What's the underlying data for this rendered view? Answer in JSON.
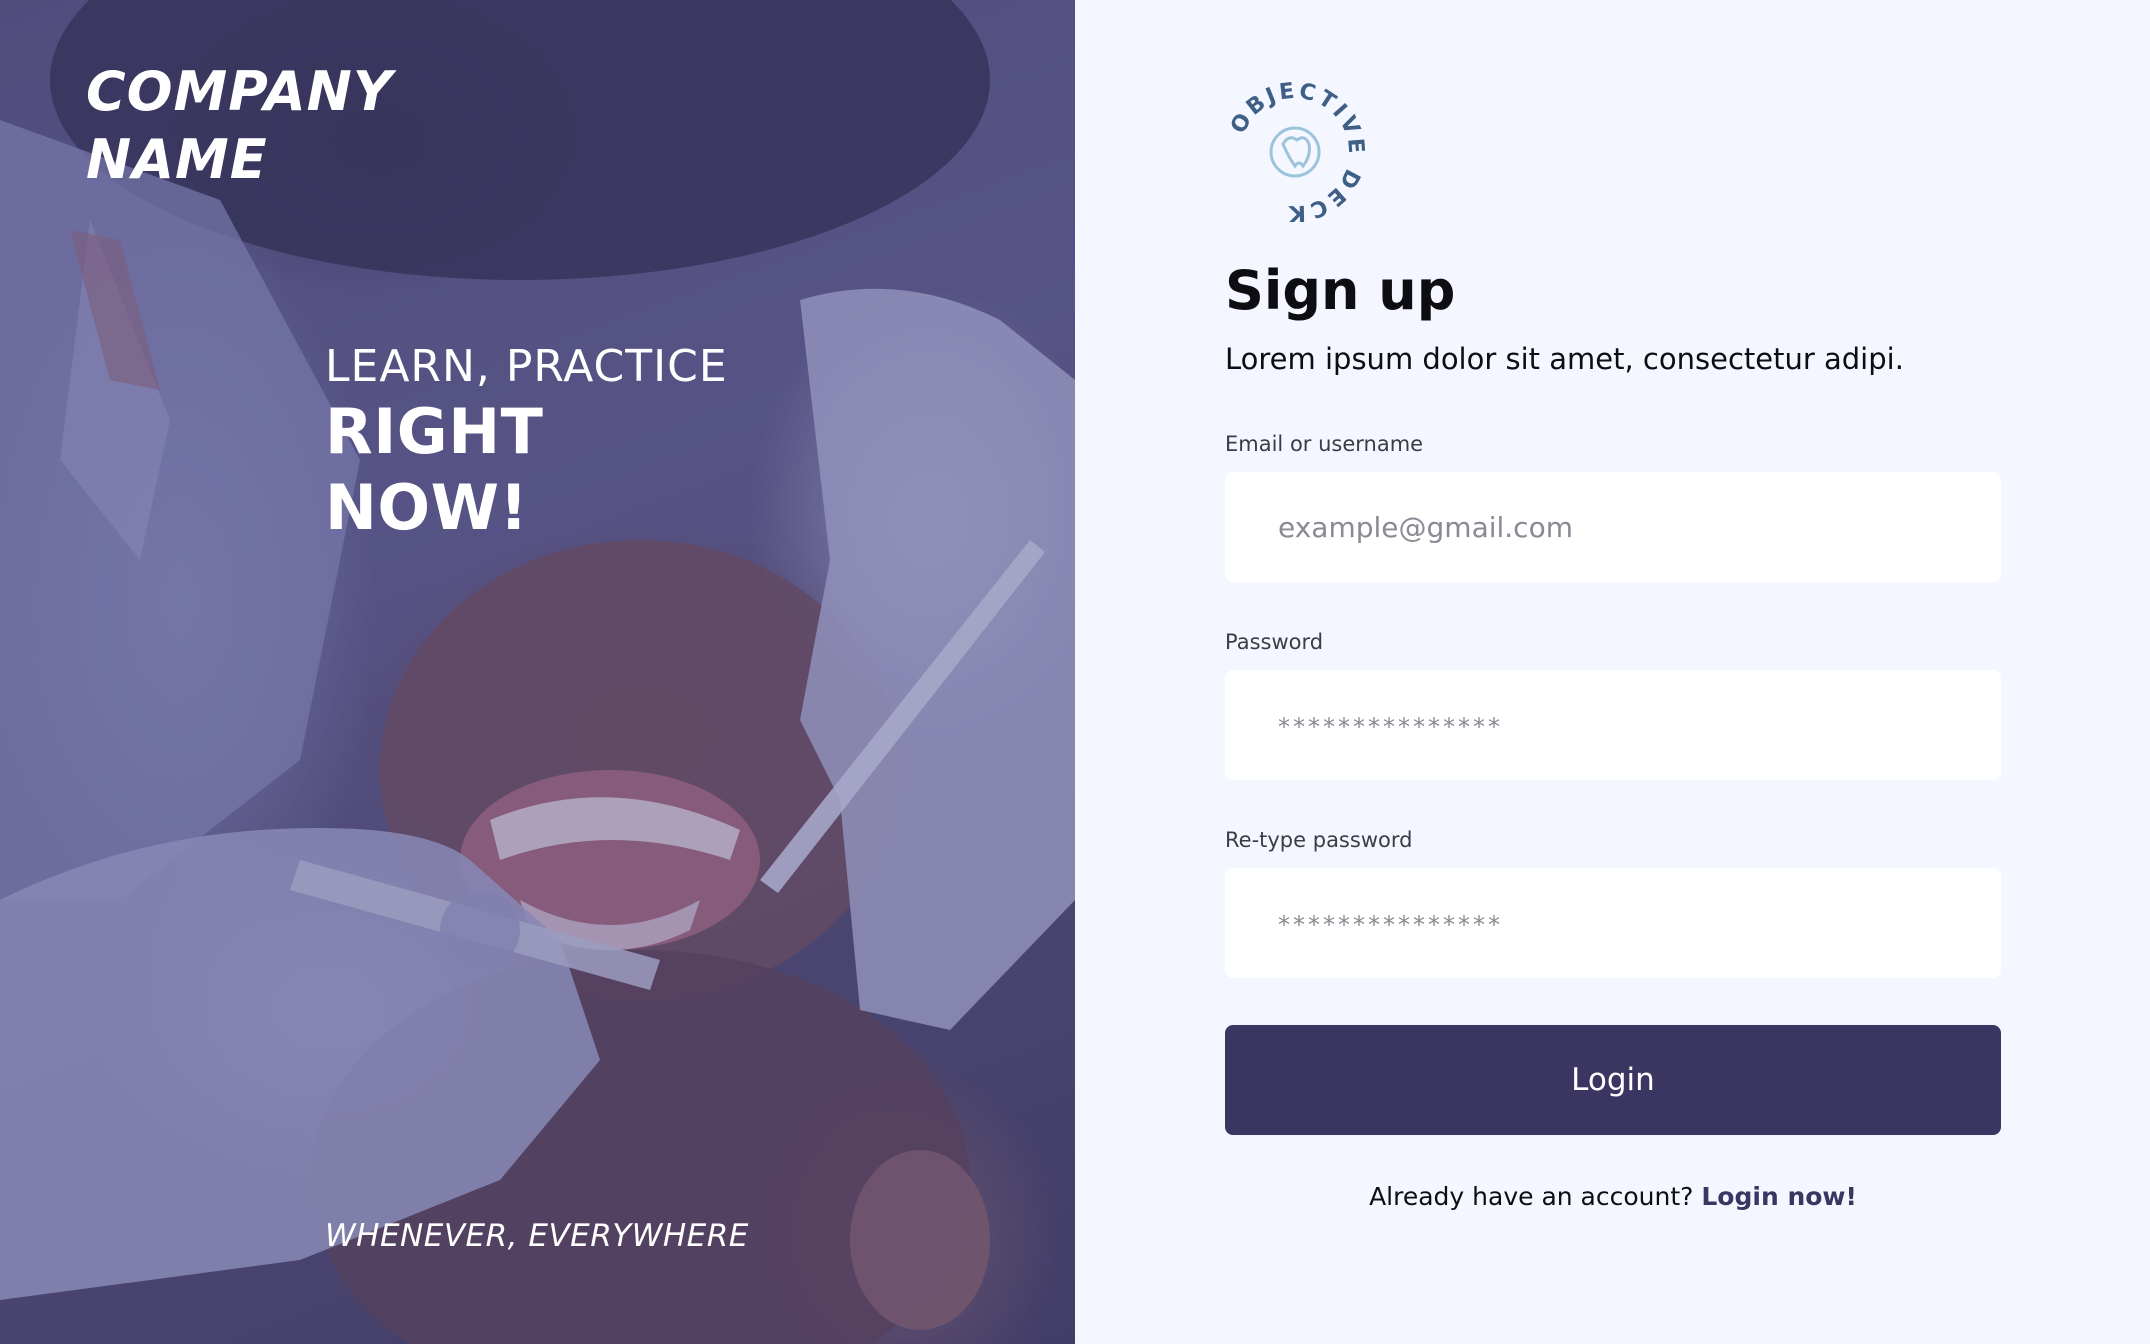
{
  "hero": {
    "company_name_line1": "COMPANY",
    "company_name_line2": "NAME",
    "tagline_line1": "LEARN, PRACTICE",
    "tagline_line2": "RIGHT NOW!",
    "footer": "WHENEVER, EVERYWHERE"
  },
  "logo": {
    "ring_text": "OBJECTIVE DECK",
    "icon": "tooth-icon"
  },
  "form": {
    "title": "Sign up",
    "subtitle": "Lorem ipsum dolor sit amet, consectetur adipi.",
    "email": {
      "label": "Email or username",
      "placeholder": "example@gmail.com"
    },
    "password": {
      "label": "Password",
      "placeholder": "***************"
    },
    "retype_password": {
      "label": "Re-type password",
      "placeholder": "***************"
    },
    "submit_label": "Login",
    "footer_text": "Already have an account?",
    "footer_link": "Login now!"
  },
  "colors": {
    "accent": "#3b3661",
    "panel_background": "#f4f7ff",
    "input_background": "#ffffff",
    "hero_overlay": "#5a588c"
  }
}
